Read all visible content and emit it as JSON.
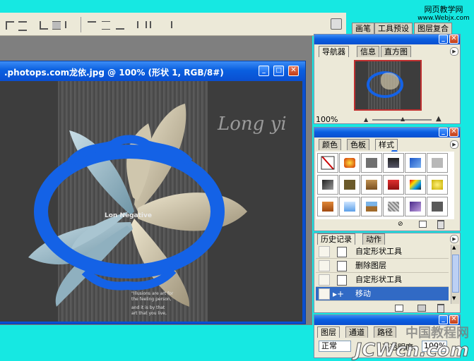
{
  "toolbar": {
    "palette_tabs": [
      "画笔",
      "工具预设",
      "图层复合"
    ]
  },
  "watermark_top": {
    "line1": "网页教学网",
    "line2": "www.Webjx.com"
  },
  "document": {
    "title": ".photops.com龙依.jpg @ 100% (形状 1, RGB/8#)",
    "canvas_text": {
      "heading": "Long yi",
      "logo": "Lon Negative",
      "quote_lines": [
        "\"Illusions are art for",
        "the feeling person,",
        "",
        "and it is by that",
        "art that you live,"
      ]
    }
  },
  "navigator_panel": {
    "tabs": [
      "导航器",
      "信息",
      "直方图"
    ],
    "zoom_value": "100%"
  },
  "styles_panel": {
    "tabs": [
      "颜色",
      "色板",
      "样式"
    ],
    "colors": {
      "accent": "#0a4fd0",
      "ellipse": "#1462e6"
    }
  },
  "history_panel": {
    "tabs": [
      "历史记录",
      "动作"
    ],
    "items": [
      {
        "label": "自定形状工具",
        "selected": false
      },
      {
        "label": "删除图层",
        "selected": false
      },
      {
        "label": "自定形状工具",
        "selected": false
      },
      {
        "label": "移动",
        "selected": true
      }
    ]
  },
  "layers_panel": {
    "tabs": [
      "图层",
      "通道",
      "路径"
    ],
    "blend_mode": "正常",
    "opacity_label": "不透明度:",
    "opacity_value": "100%"
  },
  "watermark_bottom": {
    "line1": "中国教程网",
    "line2": "JCWcn.com"
  }
}
